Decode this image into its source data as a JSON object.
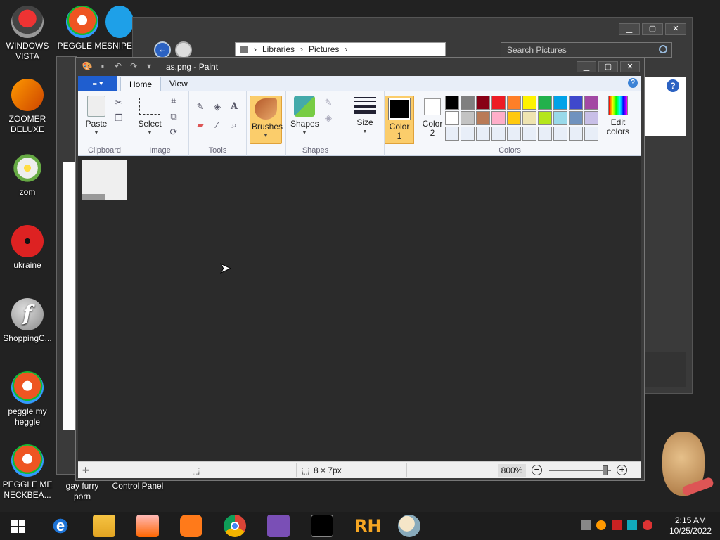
{
  "desktop": {
    "icons": [
      {
        "label_line1": "WINDOWS",
        "label_line2": "VISTA"
      },
      {
        "label_line1": "ZOOMER",
        "label_line2": "DELUXE"
      },
      {
        "label_line1": "zom",
        "label_line2": ""
      },
      {
        "label_line1": "ukraine",
        "label_line2": ""
      },
      {
        "label_line1": "ShoppingC...",
        "label_line2": ""
      },
      {
        "label_line1": "peggle my",
        "label_line2": "heggle"
      },
      {
        "label_line1": "PEGGLE ME",
        "label_line2": "NECKBEA..."
      }
    ],
    "top_icons": [
      {
        "label": "PEGGLE ME"
      },
      {
        "label": "SNIPE"
      }
    ],
    "under_labels": {
      "gay_furry_line1": "gay furry",
      "gay_furry_line2": "porn",
      "control_panel": "Control Panel"
    }
  },
  "explorer": {
    "breadcrumb": [
      "Libraries",
      "Pictures"
    ],
    "search_placeholder": "Search Pictures",
    "min": "▁",
    "max": "▢",
    "close": "✕"
  },
  "paint": {
    "title": "as.png - Paint",
    "quick_access": [
      "save-icon",
      "undo-icon",
      "redo-icon",
      "customize-icon"
    ],
    "tabs": {
      "file": "≡ ▾",
      "home": "Home",
      "view": "View"
    },
    "help": "?",
    "groups": {
      "clipboard": {
        "label": "Clipboard",
        "paste": "Paste"
      },
      "image": {
        "label": "Image",
        "select": "Select"
      },
      "tools": {
        "label": "Tools"
      },
      "brushes": {
        "label": "Brushes"
      },
      "shapes": {
        "label": "Shapes",
        "shapes": "Shapes"
      },
      "size": {
        "label": "Size"
      },
      "colors": {
        "label": "Colors",
        "color1_line1": "Color",
        "color1_line2": "1",
        "color2_line1": "Color",
        "color2_line2": "2",
        "edit_line1": "Edit",
        "edit_line2": "colors"
      }
    },
    "palette_row1": [
      "#000000",
      "#7f7f7f",
      "#880015",
      "#ed1c24",
      "#ff7f27",
      "#fff200",
      "#22b14c",
      "#00a2e8",
      "#3f48cc",
      "#a349a4"
    ],
    "palette_row2": [
      "#ffffff",
      "#c3c3c3",
      "#b97a57",
      "#ffaec9",
      "#ffc90e",
      "#efe4b0",
      "#b5e61d",
      "#99d9ea",
      "#7092be",
      "#c8bfe7"
    ],
    "palette_row3": [
      "#e8eef8",
      "#e8eef8",
      "#e8eef8",
      "#e8eef8",
      "#e8eef8",
      "#e8eef8",
      "#e8eef8",
      "#e8eef8",
      "#e8eef8",
      "#e8eef8"
    ],
    "color1": "#000000",
    "color2": "#ffffff",
    "status": {
      "size": "8 × 7px",
      "zoom": "800%",
      "zoom_minus": "−",
      "zoom_plus": "+"
    }
  },
  "taskbar": {
    "apps": [
      "internet-explorer-icon",
      "file-explorer-icon",
      "media-player-icon",
      "uc-browser-icon",
      "chrome-icon",
      "visual-studio-icon",
      "cmd-icon",
      "rh-icon",
      "paint-icon"
    ],
    "rh_label": "RH",
    "time": "2:15 AM",
    "date": "10/25/2022"
  }
}
